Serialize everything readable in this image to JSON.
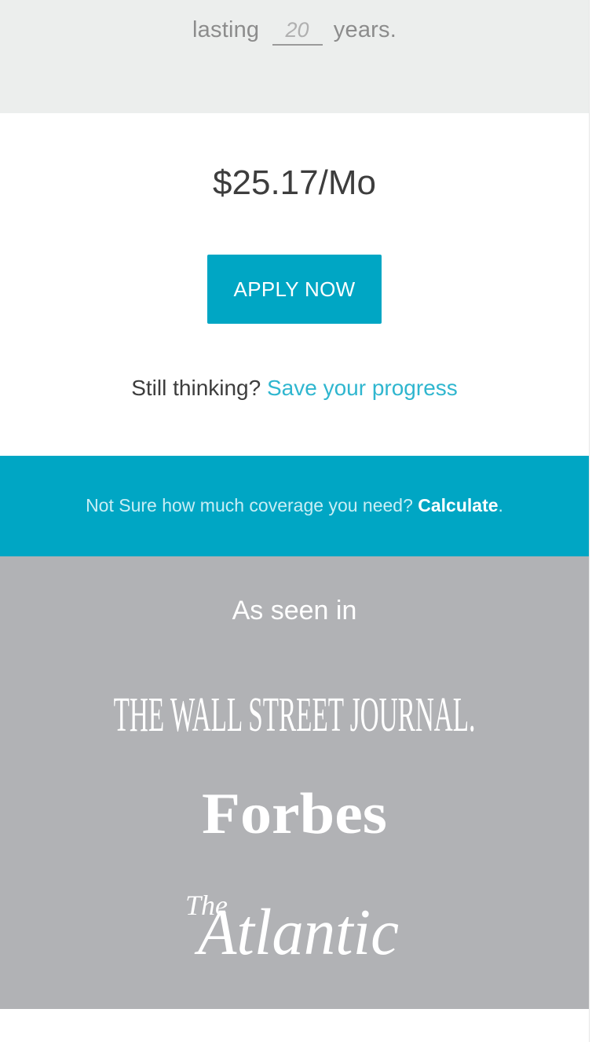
{
  "term": {
    "prefix": "lasting",
    "years_value": "20",
    "suffix": "years."
  },
  "quote": {
    "price": "$25.17/Mo",
    "apply_label": "APPLY NOW",
    "still_thinking": "Still thinking?",
    "save_progress_label": "Save your progress"
  },
  "calculator": {
    "prompt": "Not Sure how much coverage you need?",
    "link_label": "Calculate",
    "trailing": "."
  },
  "press": {
    "heading": "As seen in",
    "logos": [
      {
        "name": "wsj",
        "text": "THE WALL STREET JOURNAL."
      },
      {
        "name": "forbes",
        "text": "Forbes"
      },
      {
        "name": "atlantic",
        "prefix": "The",
        "text": "Atlantic"
      }
    ]
  },
  "colors": {
    "accent": "#00a6c4",
    "link": "#2fb6cf",
    "press_bg": "#b1b2b5",
    "top_bg": "#eceeed"
  }
}
